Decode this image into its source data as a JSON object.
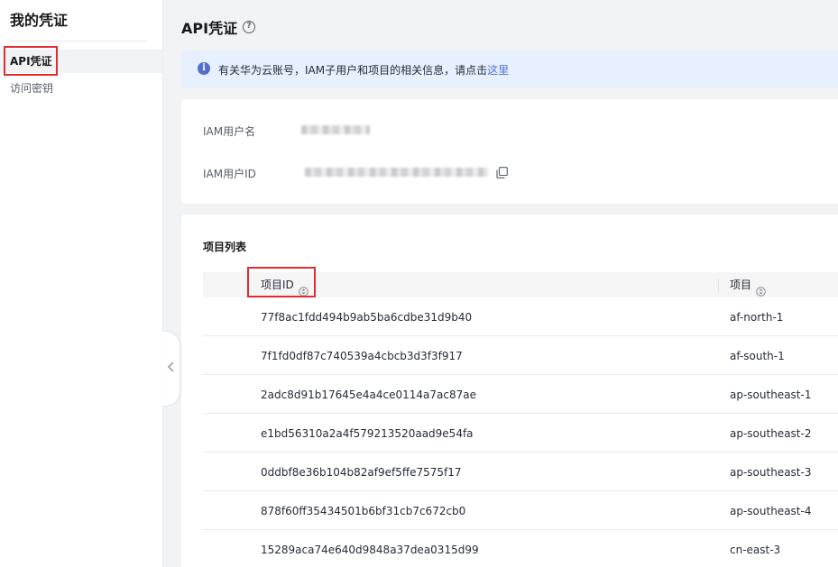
{
  "sidebar": {
    "title": "我的凭证",
    "items": [
      {
        "label": "API凭证",
        "active": true
      },
      {
        "label": "访问密钥",
        "active": false
      }
    ]
  },
  "main": {
    "title": "API凭证",
    "help_icon": "question-circle-icon",
    "info": {
      "text": "有关华为云账号，IAM子用户和项目的相关信息，请点击",
      "link": "这里"
    },
    "user": {
      "name_label": "IAM用户名",
      "id_label": "IAM用户ID"
    },
    "project_list": {
      "title": "项目列表",
      "columns": [
        {
          "label": "项目ID"
        },
        {
          "label": "项目"
        }
      ],
      "rows": [
        {
          "id": "77f8ac1fdd494b9ab5ba6cdbe31d9b40",
          "project": "af-north-1"
        },
        {
          "id": "7f1fd0df87c740539a4cbcb3d3f3f917",
          "project": "af-south-1"
        },
        {
          "id": "2adc8d91b17645e4a4ce0114a7ac87ae",
          "project": "ap-southeast-1"
        },
        {
          "id": "e1bd56310a2a4f579213520aad9e54fa",
          "project": "ap-southeast-2"
        },
        {
          "id": "0ddbf8e36b104b82af9ef5ffe7575f17",
          "project": "ap-southeast-3"
        },
        {
          "id": "878f60ff35434501b6bf31cb7c672cb0",
          "project": "ap-southeast-4"
        },
        {
          "id": "15289aca74e640d9848a37dea0315d99",
          "project": "cn-east-3"
        }
      ]
    }
  },
  "colors": {
    "accent": "#526ecc",
    "highlight_box": "#e12d2d",
    "info_bg": "#e6f0ff"
  }
}
